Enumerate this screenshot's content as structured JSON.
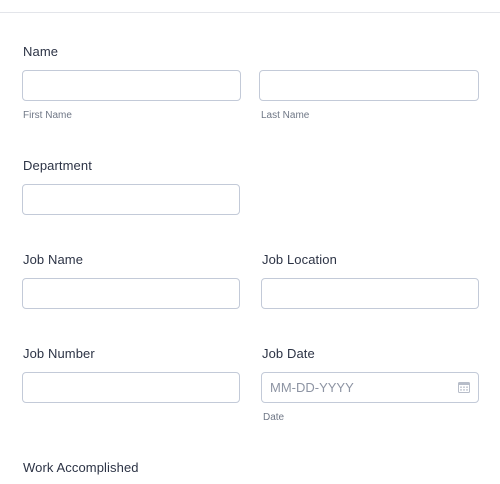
{
  "form": {
    "name": {
      "label": "Name",
      "first_sublabel": "First Name",
      "last_sublabel": "Last Name",
      "first_value": "",
      "last_value": ""
    },
    "department": {
      "label": "Department",
      "value": ""
    },
    "job_name": {
      "label": "Job Name",
      "value": ""
    },
    "job_location": {
      "label": "Job Location",
      "value": ""
    },
    "job_number": {
      "label": "Job Number",
      "value": ""
    },
    "job_date": {
      "label": "Job Date",
      "placeholder": "MM-DD-YYYY",
      "sublabel": "Date",
      "icon": "calendar-icon"
    },
    "work_accomplished": {
      "label": "Work Accomplished"
    }
  }
}
